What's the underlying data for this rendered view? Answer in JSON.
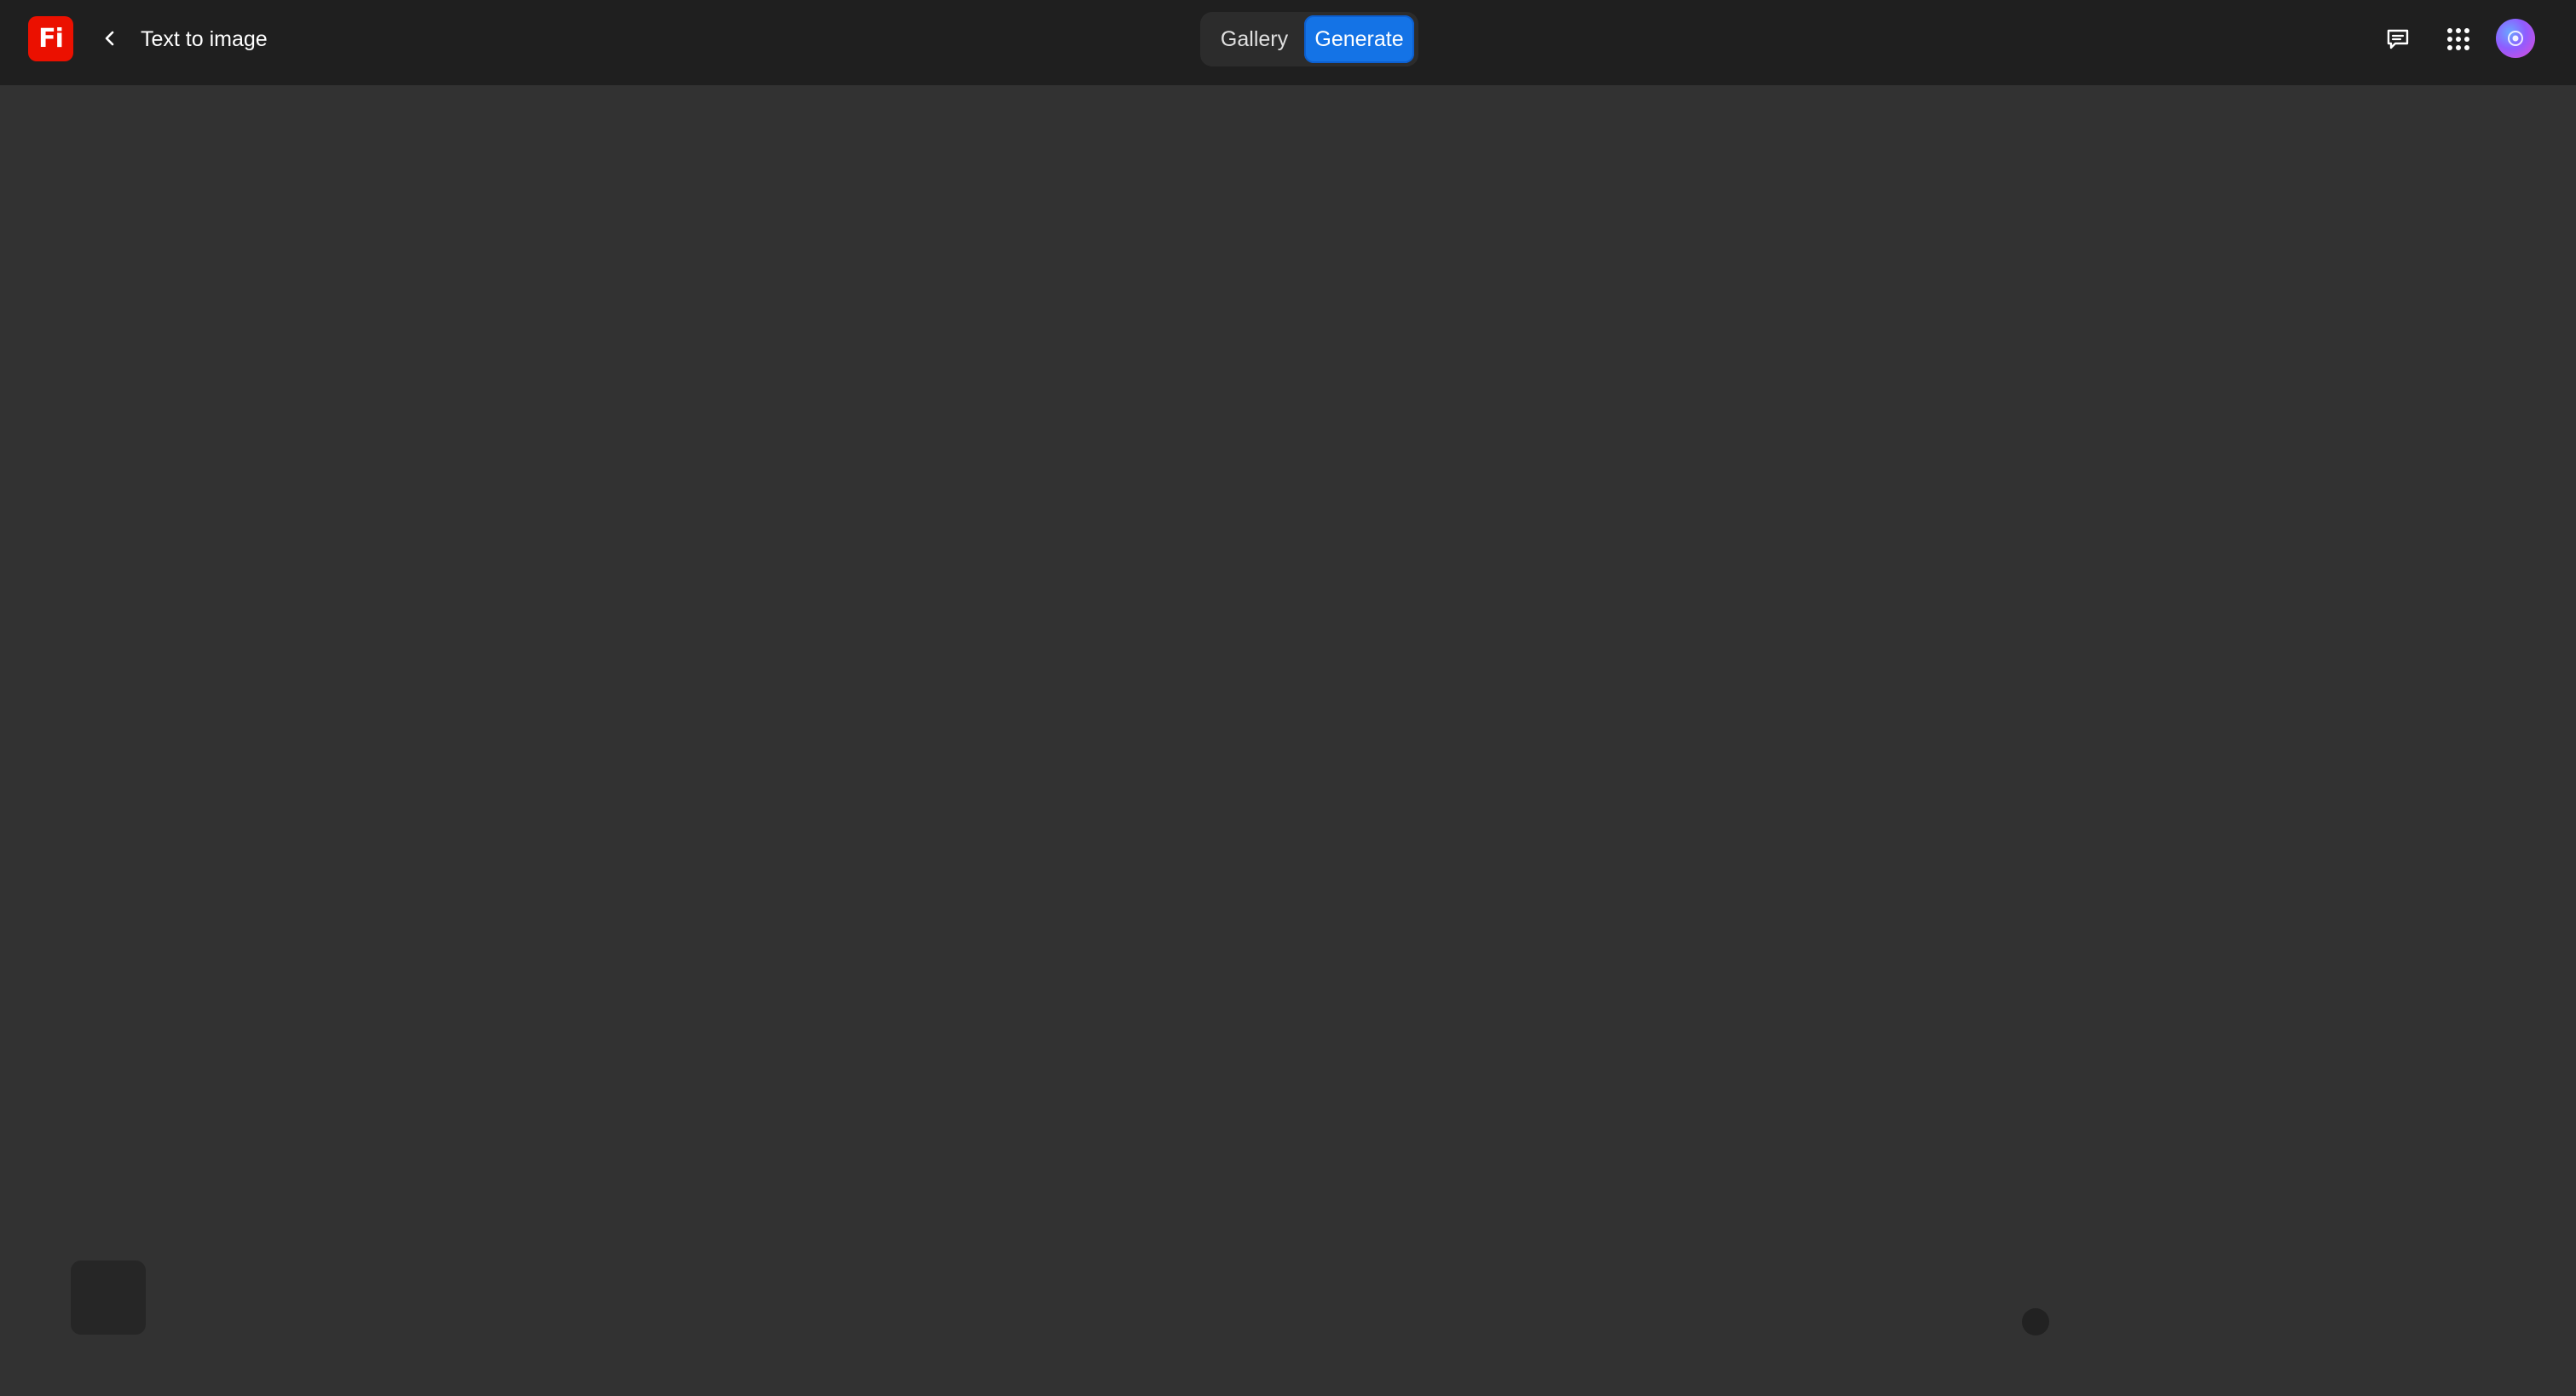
{
  "app": {
    "logo_text": "Fi",
    "brand_color": "#eb1000",
    "title": "Text to image"
  },
  "header": {
    "back_icon": "chevron-left-icon",
    "mode_switch": {
      "gallery_label": "Gallery",
      "generate_label": "Generate",
      "active": "Generate",
      "active_color": "#1473e6"
    },
    "right_icons": [
      "feedback-icon",
      "apps-grid-icon",
      "avatar"
    ]
  },
  "colors": {
    "topbar_bg": "#1f1f1f",
    "canvas_bg": "#323232"
  }
}
